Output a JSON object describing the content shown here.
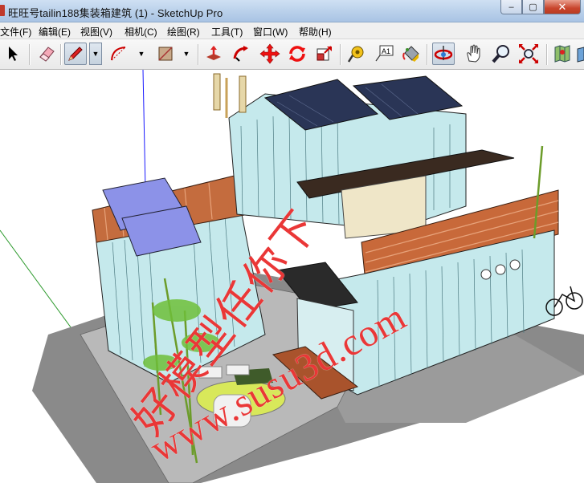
{
  "window": {
    "title": "旺旺号tailin188集装箱建筑 (1) - SketchUp Pro",
    "minimize_glyph": "–",
    "maximize_glyph": "▢",
    "close_glyph": "✕"
  },
  "menu": {
    "items": [
      {
        "label": "文件(F)"
      },
      {
        "label": "编辑(E)"
      },
      {
        "label": "视图(V)"
      },
      {
        "label": "相机(C)"
      },
      {
        "label": "绘图(R)"
      },
      {
        "label": "工具(T)"
      },
      {
        "label": "窗口(W)"
      },
      {
        "label": "帮助(H)"
      }
    ]
  },
  "toolbar": {
    "tools": [
      {
        "icon": "select-arrow-icon"
      },
      {
        "icon": "eraser-icon"
      },
      {
        "icon": "pencil-line-icon",
        "active": true
      },
      {
        "icon": "arc-icon"
      },
      {
        "icon": "rectangle-icon"
      },
      {
        "icon": "push-pull-icon"
      },
      {
        "icon": "follow-me-icon"
      },
      {
        "icon": "move-icon"
      },
      {
        "icon": "rotate-icon"
      },
      {
        "icon": "scale-icon"
      },
      {
        "icon": "tape-measure-icon"
      },
      {
        "icon": "text-icon"
      },
      {
        "icon": "paint-bucket-icon"
      },
      {
        "icon": "orbit-icon",
        "active": true
      },
      {
        "icon": "pan-icon"
      },
      {
        "icon": "zoom-icon"
      },
      {
        "icon": "zoom-extents-icon"
      },
      {
        "icon": "map-location-icon"
      }
    ],
    "text_tool_label": "A1"
  },
  "viewport": {
    "watermark_line1": "好模型任你下",
    "watermark_line2": "www.susu3d.com",
    "colors": {
      "container_blue": "#bfe6ea",
      "deck_wood": "#c8693a",
      "solar_panel": "#2a3556",
      "blue_panel": "#8c92e8",
      "shadow": "#8a8a8a",
      "watermark": "#e61414"
    }
  }
}
